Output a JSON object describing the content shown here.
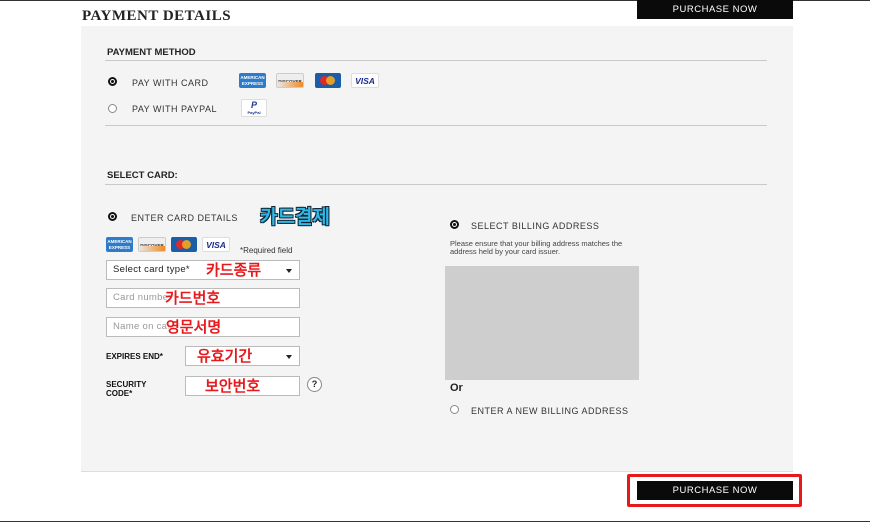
{
  "page": {
    "title": "PAYMENT DETAILS",
    "purchase_top_label": "PURCHASE NOW",
    "purchase_bottom_label": "PURCHASE NOW"
  },
  "payment_method": {
    "heading": "PAYMENT METHOD",
    "options": [
      {
        "label": "PAY WITH CARD",
        "selected": true
      },
      {
        "label": "PAY WITH PAYPAL",
        "selected": false
      }
    ],
    "card_brands": [
      "AMERICAN EXPRESS",
      "DISCOVER",
      "MasterCard",
      "VISA"
    ],
    "paypal_brand": "PayPal"
  },
  "select_card": {
    "heading": "SELECT CARD:",
    "enter_details_label": "ENTER CARD DETAILS",
    "card_brands": [
      "AMERICAN EXPRESS",
      "DISCOVER",
      "MasterCard",
      "VISA"
    ],
    "required_note": "*Required field",
    "card_type_value": "Select card type*",
    "card_number_placeholder": "Card number*",
    "name_placeholder": "Name on card*",
    "expires_label": "EXPIRES END*",
    "security_label_line1": "SECURITY",
    "security_label_line2": "CODE*",
    "help_icon_text": "?"
  },
  "billing": {
    "select_label": "SELECT BILLING ADDRESS",
    "notice": "Please ensure that your billing address matches the address held by your card issuer.",
    "or_label": "Or",
    "new_address_label": "ENTER A NEW BILLING ADDRESS"
  },
  "annotations": {
    "card_payment": "카드결제",
    "card_type": "카드종류",
    "card_number": "카드번호",
    "english_name": "영문서명",
    "expiry": "유효기간",
    "security_code": "보안번호"
  },
  "colors": {
    "highlight": "#e8191c",
    "button": "#0a0a0a",
    "panel": "#f4f4f4"
  }
}
